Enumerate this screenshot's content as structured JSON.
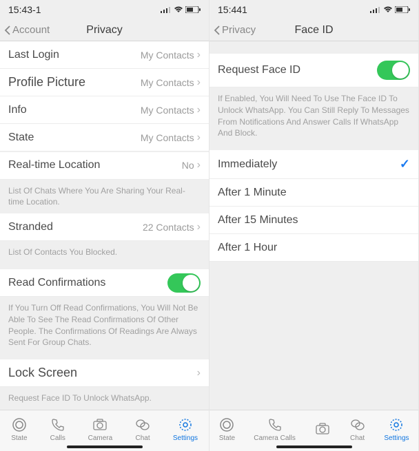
{
  "left": {
    "status": {
      "time": "15:43-1"
    },
    "nav": {
      "back": "Account",
      "title": "Privacy"
    },
    "rows": {
      "lastLogin": {
        "label": "Last Login",
        "value": "My Contacts"
      },
      "profilePic": {
        "label": "Profile Picture",
        "value": "My Contacts"
      },
      "info": {
        "label": "Info",
        "value": "My Contacts"
      },
      "state": {
        "label": "State",
        "value": "My Contacts"
      },
      "realtime": {
        "label": "Real-time Location",
        "value": "No"
      },
      "realtimeDesc": "List Of Chats Where You Are Sharing Your Real-time Location.",
      "stranded": {
        "label": "Stranded",
        "value": "22 Contacts"
      },
      "strandedDesc": "List Of Contacts You Blocked.",
      "readConfirm": {
        "label": "Read Confirmations"
      },
      "readConfirmDesc": "If You Turn Off Read Confirmations, You Will Not Be Able To See The Read Confirmations Of Other People. The Confirmations Of Readings Are Always Sent For Group Chats.",
      "lockScreen": {
        "label": "Lock Screen"
      },
      "lockScreenDesc": "Request Face ID To Unlock WhatsApp."
    },
    "tabs": {
      "state": "State",
      "calls": "Calls",
      "camera": "Camera",
      "chat": "Chat",
      "settings": "Settings"
    }
  },
  "right": {
    "status": {
      "time": "15:441"
    },
    "nav": {
      "back": "Privacy",
      "title": "Face ID"
    },
    "rows": {
      "request": {
        "label": "Request Face ID"
      },
      "requestDesc": "If Enabled, You Will Need To Use The Face ID To Unlock WhatsApp. You Can Still Reply To Messages From Notifications And Answer Calls If WhatsApp And Block.",
      "immediately": "Immediately",
      "after1m": "After 1 Minute",
      "after15m": "After 15 Minutes",
      "after1h": "After 1 Hour"
    },
    "tabs": {
      "state": "State",
      "calls": "Camera Calls",
      "camera": "",
      "chat": "Chat",
      "settings": "Settings"
    }
  }
}
